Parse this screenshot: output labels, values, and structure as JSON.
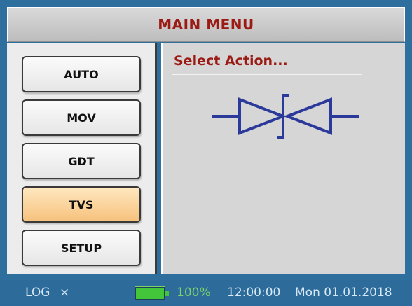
{
  "header": {
    "title": "MAIN MENU"
  },
  "menu": {
    "selected": "TVS",
    "items": [
      {
        "label": "AUTO"
      },
      {
        "label": "MOV"
      },
      {
        "label": "GDT"
      },
      {
        "label": "TVS"
      },
      {
        "label": "SETUP"
      }
    ]
  },
  "content": {
    "title": "Select Action...",
    "symbol": "tvs-diode-symbol-icon"
  },
  "status": {
    "log_label": "LOG",
    "close_glyph": "×",
    "battery_level": 1.0,
    "battery_percent": "100%",
    "time": "12:00:00",
    "date": "Mon 01.01.2018"
  },
  "colors": {
    "accent": "#9b1b14",
    "selected_button": "#f6c27d",
    "symbol": "#2b3a9a",
    "status_bar": "#2d6c9a",
    "battery": "#44c63a"
  }
}
